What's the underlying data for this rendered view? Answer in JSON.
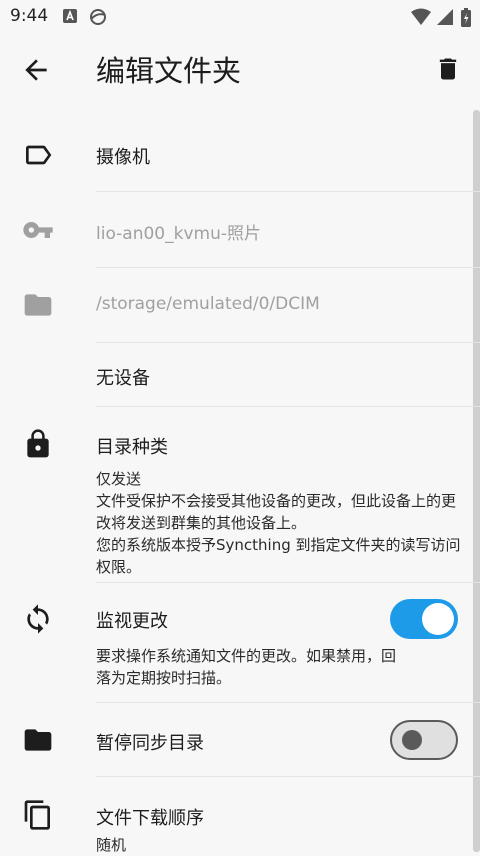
{
  "status": {
    "time": "9:44"
  },
  "appbar": {
    "title": "编辑文件夹"
  },
  "rows": {
    "label": "摄像机",
    "folder_id": "lio-an00_kvmu-照片",
    "path": "/storage/emulated/0/DCIM",
    "devices": "无设备",
    "folder_type_title": "目录种类",
    "folder_type_value": "仅发送",
    "folder_type_desc": "文件受保护不会接受其他设备的更改，但此设备上的更改将发送到群集的其他设备上。",
    "folder_type_note": "您的系统版本授予Syncthing 到指定文件夹的读写访问权限。",
    "watch_title": "监视更改",
    "watch_desc": "要求操作系统通知文件的更改。如果禁用，回落为定期按时扫描。",
    "watch_on": true,
    "pause_title": "暂停同步目录",
    "pause_on": false,
    "order_title": "文件下载顺序",
    "order_value": "随机"
  }
}
